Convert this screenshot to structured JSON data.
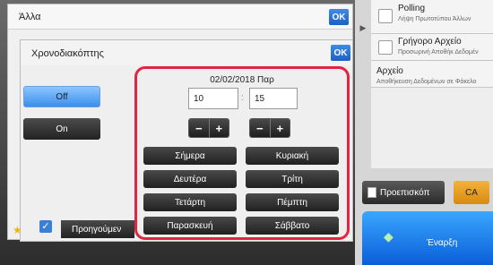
{
  "right_panel": {
    "items": [
      {
        "title": "Polling",
        "subtitle": "Λήψη Πρωτοτύπου Άλλων",
        "checkbox": true
      },
      {
        "title": "Γρήγορο Αρχείο",
        "subtitle": "Προσωρινή Αποθήκ Δεδομέν",
        "checkbox": true
      },
      {
        "title": "Αρχείο",
        "subtitle": "Αποθήκευση Δεδομένων σε Φάκελο",
        "checkbox": false
      }
    ],
    "preview_label": "Προεπισκόπ",
    "ca_label": "CA",
    "start_label": "Έναρξη"
  },
  "dialog_outer": {
    "title": "Άλλα",
    "ok_label": "OK"
  },
  "dialog_inner": {
    "title": "Χρονοδιακόπτης",
    "ok_label": "OK",
    "off_label": "Off",
    "on_label": "On",
    "selected": "Off",
    "date": "02/02/2018 Παρ",
    "hour": "10",
    "minute": "15",
    "separator": ":",
    "days": [
      "Σήμερα",
      "Κυριακή",
      "Δευτέρα",
      "Τρίτη",
      "Τετάρτη",
      "Πέμπτη",
      "Παρασκευή",
      "Σάββατο"
    ]
  },
  "bottom": {
    "prev_label": "Προηγούμεν"
  },
  "colors": {
    "accent_blue": "#1e5fc4",
    "frame_red": "#e32440",
    "ca_orange": "#f3b23a",
    "start_blue": "#0a5ed8"
  }
}
